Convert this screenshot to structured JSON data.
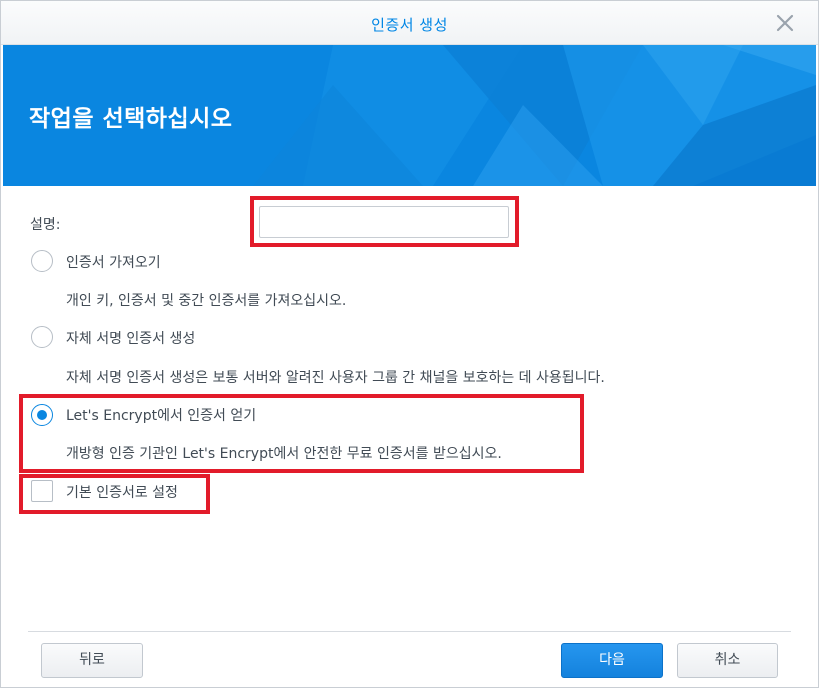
{
  "window": {
    "title": "인증서 생성",
    "close_icon": "close-icon"
  },
  "banner": {
    "heading": "작업을 선택하십시오",
    "color": "#0a86e0"
  },
  "form": {
    "description_label": "설명:",
    "description_value": "",
    "options": [
      {
        "label": "인증서 가져오기",
        "sublabel": "개인 키, 인증서 및 중간 인증서를 가져오십시오.",
        "selected": false
      },
      {
        "label": "자체 서명 인증서 생성",
        "sublabel": "자체 서명 인증서 생성은 보통 서버와 알려진 사용자 그룹 간 채널을 보호하는 데 사용됩니다.",
        "selected": false
      },
      {
        "label": "Let's Encrypt에서 인증서 얻기",
        "sublabel": "개방형 인증 기관인 Let's Encrypt에서 안전한 무료 인증서를 받으십시오.",
        "selected": true
      }
    ],
    "default_checkbox_label": "기본 인증서로 설정",
    "default_checked": false
  },
  "footer": {
    "back_label": "뒤로",
    "next_label": "다음",
    "cancel_label": "취소"
  },
  "colors": {
    "accent": "#0a86e0",
    "highlight": "#e21b2a"
  }
}
